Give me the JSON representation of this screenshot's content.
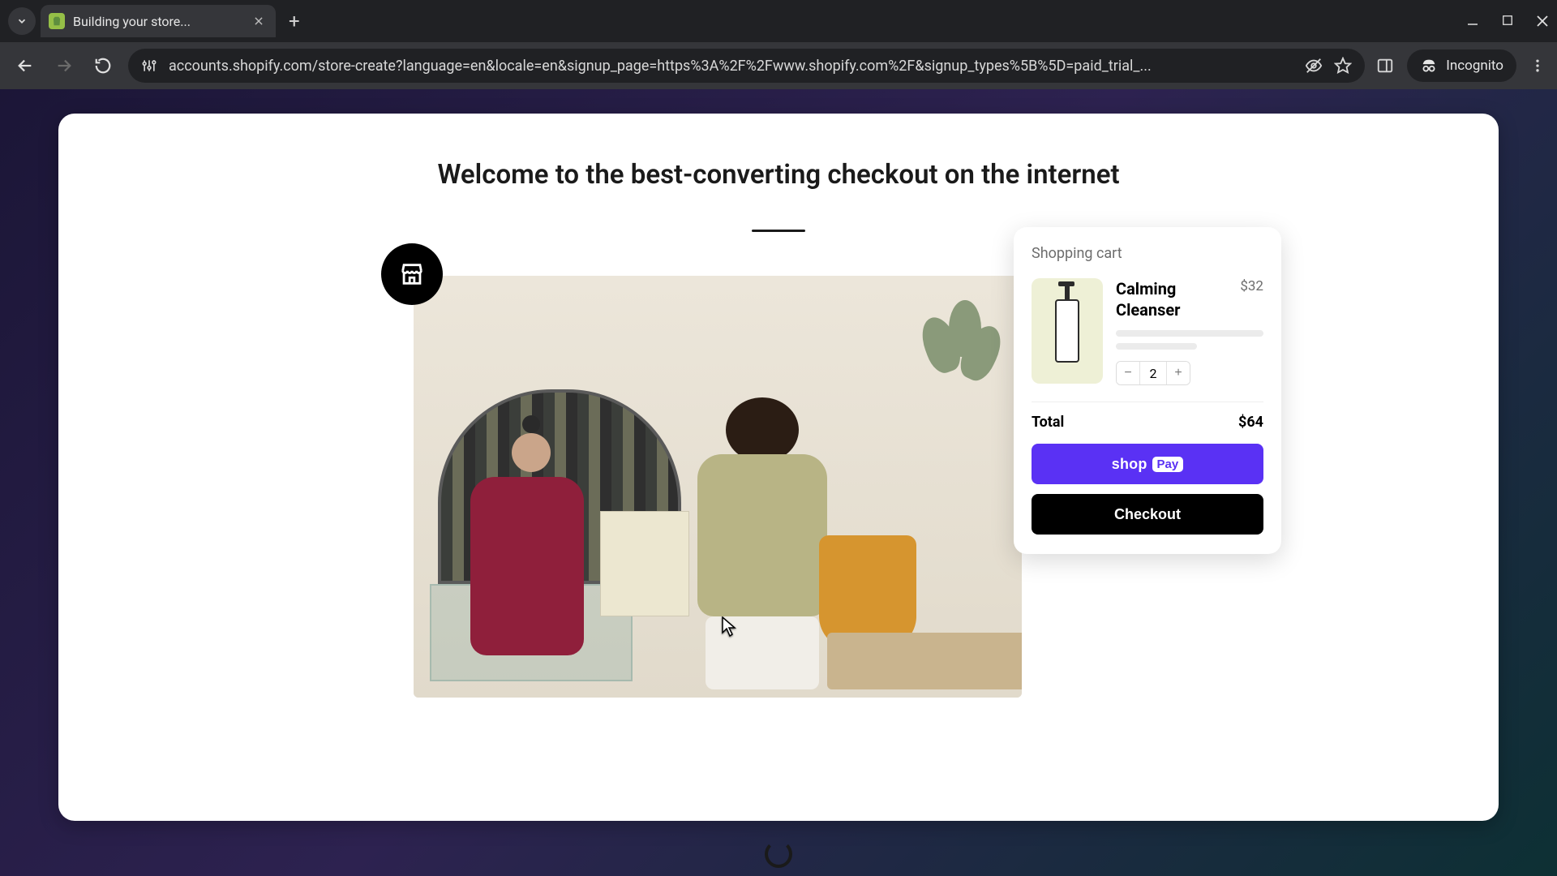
{
  "browser": {
    "tab_title": "Building your store...",
    "url": "accounts.shopify.com/store-create?language=en&locale=en&signup_page=https%3A%2F%2Fwww.shopify.com%2F&signup_types%5B%5D=paid_trial_...",
    "incognito_label": "Incognito"
  },
  "page": {
    "headline": "Welcome to the best-converting checkout on the internet"
  },
  "cart": {
    "title": "Shopping cart",
    "item": {
      "name": "Calming Cleanser",
      "price": "$32",
      "quantity": "2"
    },
    "total_label": "Total",
    "total_value": "$64",
    "shoppay_word": "shop",
    "shoppay_badge": "Pay",
    "checkout_label": "Checkout"
  }
}
